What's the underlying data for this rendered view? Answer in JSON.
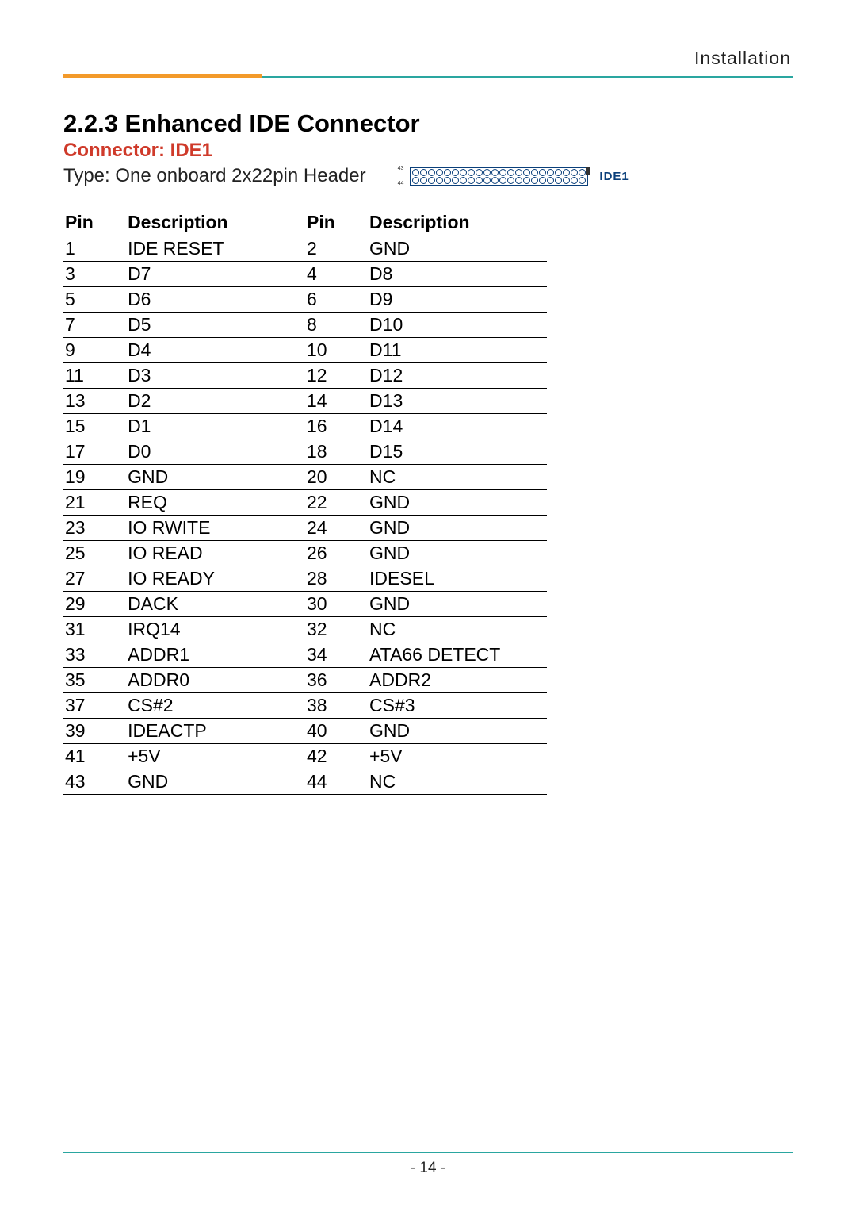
{
  "header_label": "Installation",
  "section_title": "2.2.3 Enhanced IDE Connector",
  "connector_title": "Connector: IDE1",
  "type_text": "Type: One onboard 2x22pin Header",
  "diagram_label": "IDE1",
  "diagram_pin_left_top": "43",
  "diagram_pin_left_bottom": "44",
  "table_headers": {
    "pin": "Pin",
    "desc": "Description"
  },
  "chart_data": {
    "type": "table",
    "title": "IDE1 pinout",
    "columns": [
      "Pin",
      "Description",
      "Pin",
      "Description"
    ],
    "rows": [
      {
        "pin_a": "1",
        "desc_a": "IDE RESET",
        "pin_b": "2",
        "desc_b": "GND"
      },
      {
        "pin_a": "3",
        "desc_a": "D7",
        "pin_b": "4",
        "desc_b": "D8"
      },
      {
        "pin_a": "5",
        "desc_a": "D6",
        "pin_b": "6",
        "desc_b": "D9"
      },
      {
        "pin_a": "7",
        "desc_a": "D5",
        "pin_b": "8",
        "desc_b": "D10"
      },
      {
        "pin_a": "9",
        "desc_a": "D4",
        "pin_b": "10",
        "desc_b": "D11"
      },
      {
        "pin_a": "11",
        "desc_a": "D3",
        "pin_b": "12",
        "desc_b": "D12"
      },
      {
        "pin_a": "13",
        "desc_a": "D2",
        "pin_b": "14",
        "desc_b": "D13"
      },
      {
        "pin_a": "15",
        "desc_a": "D1",
        "pin_b": "16",
        "desc_b": "D14"
      },
      {
        "pin_a": "17",
        "desc_a": "D0",
        "pin_b": "18",
        "desc_b": "D15"
      },
      {
        "pin_a": "19",
        "desc_a": "GND",
        "pin_b": "20",
        "desc_b": "NC"
      },
      {
        "pin_a": "21",
        "desc_a": "REQ",
        "pin_b": "22",
        "desc_b": "GND"
      },
      {
        "pin_a": "23",
        "desc_a": "IO RWITE",
        "pin_b": "24",
        "desc_b": "GND"
      },
      {
        "pin_a": "25",
        "desc_a": "IO READ",
        "pin_b": "26",
        "desc_b": "GND"
      },
      {
        "pin_a": "27",
        "desc_a": "IO READY",
        "pin_b": "28",
        "desc_b": "IDESEL"
      },
      {
        "pin_a": "29",
        "desc_a": "DACK",
        "pin_b": "30",
        "desc_b": "GND"
      },
      {
        "pin_a": "31",
        "desc_a": "IRQ14",
        "pin_b": "32",
        "desc_b": "NC"
      },
      {
        "pin_a": "33",
        "desc_a": "ADDR1",
        "pin_b": "34",
        "desc_b": "ATA66 DETECT"
      },
      {
        "pin_a": "35",
        "desc_a": "ADDR0",
        "pin_b": "36",
        "desc_b": "ADDR2"
      },
      {
        "pin_a": "37",
        "desc_a": "CS#2",
        "pin_b": "38",
        "desc_b": "CS#3"
      },
      {
        "pin_a": "39",
        "desc_a": "IDEACTP",
        "pin_b": "40",
        "desc_b": "GND"
      },
      {
        "pin_a": "41",
        "desc_a": "+5V",
        "pin_b": "42",
        "desc_b": "+5V"
      },
      {
        "pin_a": "43",
        "desc_a": "GND",
        "pin_b": "44",
        "desc_b": "NC"
      }
    ]
  },
  "page_number": "- 14 -"
}
